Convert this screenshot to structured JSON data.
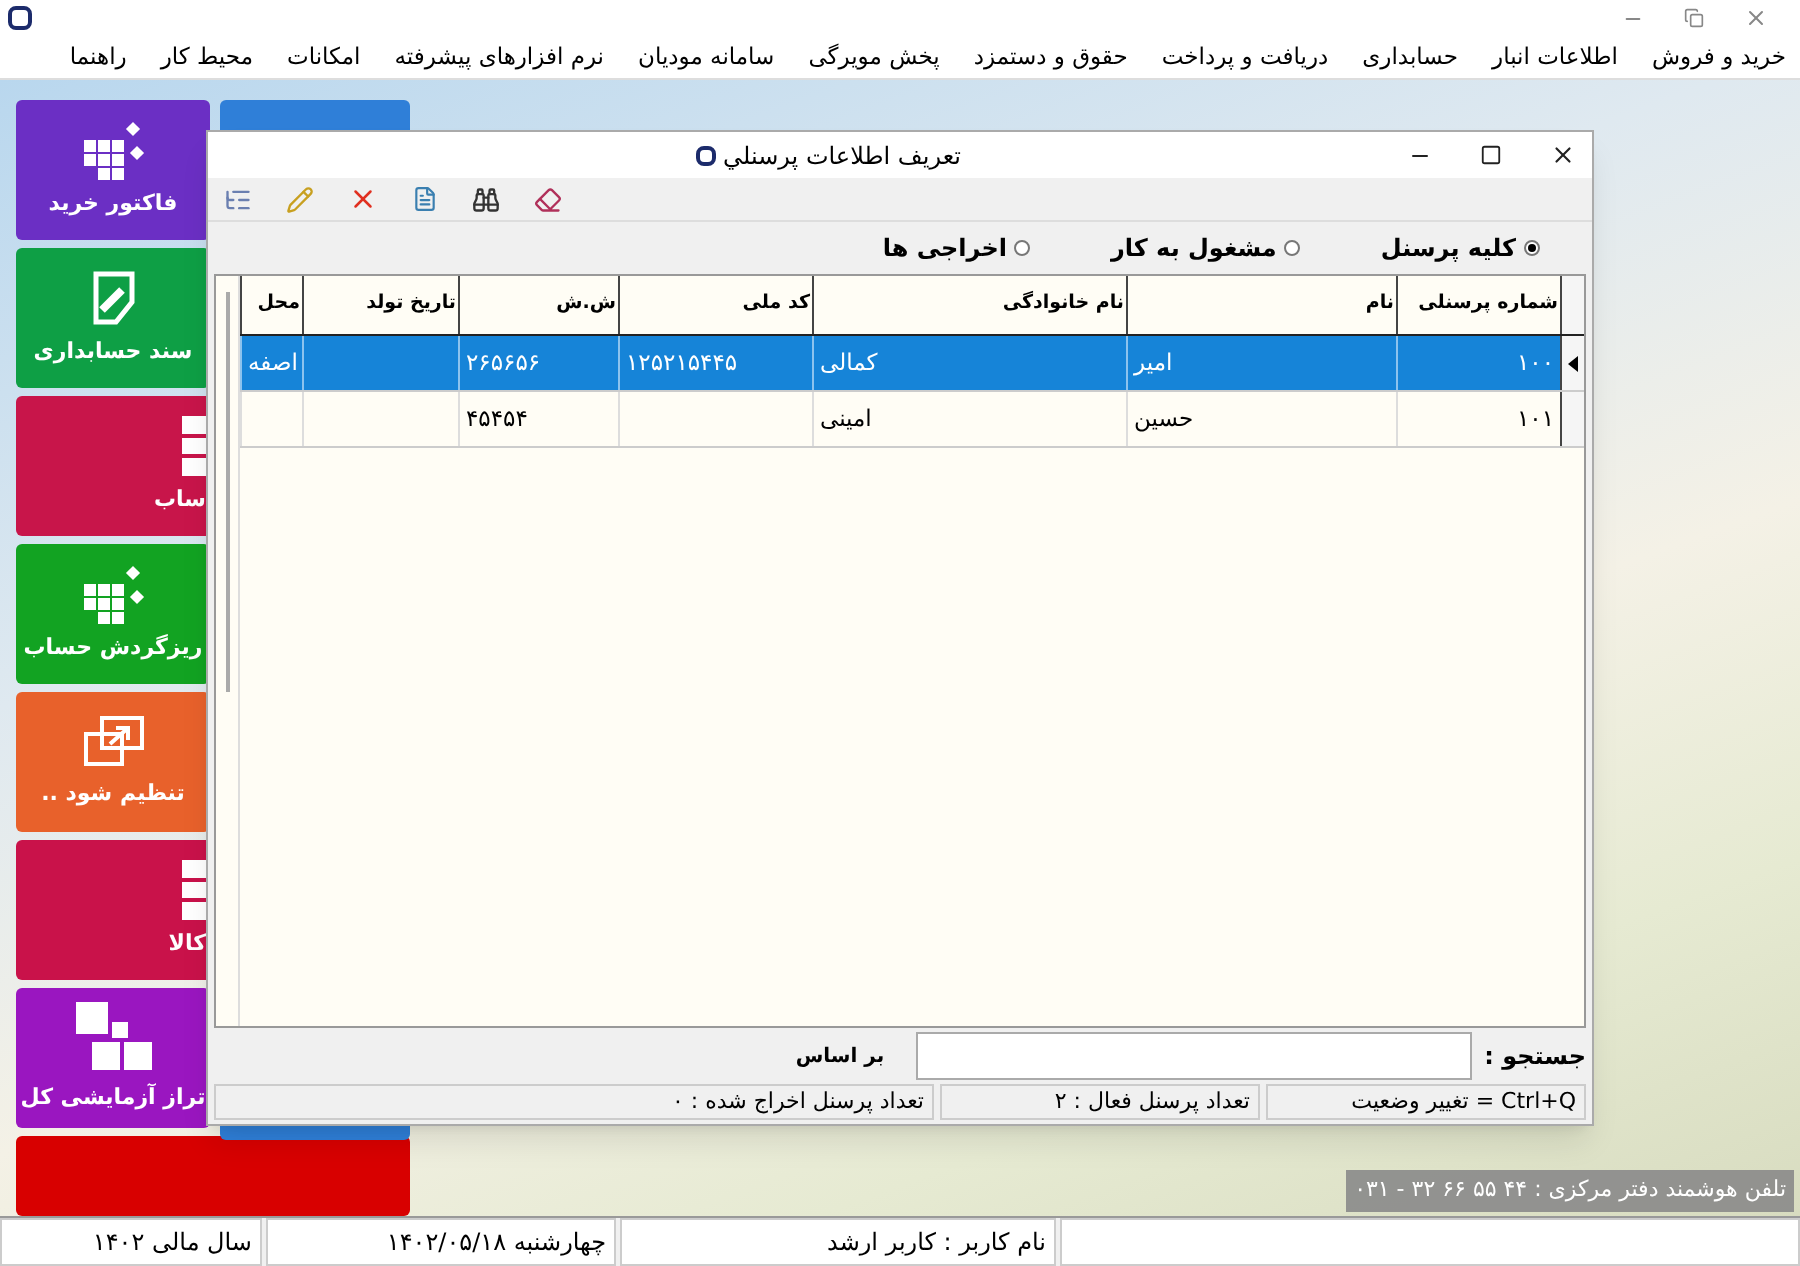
{
  "menu": [
    "خرید و فروش",
    "اطلاعات انبار",
    "حسابداری",
    "دریافت و پرداخت",
    "حقوق و دستمزد",
    "پخش مویرگی",
    "سامانه مودیان",
    "نرم افزارهای پیشرفته",
    "امکانات",
    "محیط کار",
    "راهنما"
  ],
  "tiles": [
    {
      "label": "فاکتور خرید",
      "color": "#6b2fc4",
      "kind": "cubes"
    },
    {
      "label": "سند حسابداری",
      "color": "#0e9f45",
      "kind": "note"
    },
    {
      "label": "ساب",
      "color": "#c8154a",
      "kind": "grid"
    },
    {
      "label": "ریزگردش حساب",
      "color": "#12a322",
      "kind": "cubes"
    },
    {
      "label": "تنظیم شود ..",
      "color": "#e8612b",
      "kind": "external"
    },
    {
      "label": "کالا",
      "color": "#c9124a",
      "kind": "grid"
    },
    {
      "label": "تراز آزمایشی کل",
      "color": "#9a16c0",
      "kind": "squares"
    },
    {
      "color": "#d80000",
      "kind": "blank"
    }
  ],
  "dialog": {
    "title": "تعریف اطلاعات پرسنلي",
    "radios": [
      {
        "label": "کلیه پرسنل",
        "selected": true
      },
      {
        "label": "مشغول به کار",
        "selected": false
      },
      {
        "label": "اخراجی ها",
        "selected": false
      }
    ],
    "table": {
      "columns": [
        "شماره پرسنلی",
        "نام",
        "نام خانوادگی",
        "کد ملی",
        "ش.ش",
        "تاریخ تولد",
        "محل"
      ],
      "rows": [
        {
          "selected": true,
          "cells": [
            "۱۰۰",
            "امیر",
            "کمالی",
            "۱۲۵۲۱۵۴۴۵",
            "۲۶۵۶۵۶",
            "",
            "اصفه"
          ]
        },
        {
          "selected": false,
          "cells": [
            "۱۰۱",
            "حسین",
            "امینی",
            "",
            "۴۵۴۵۴",
            "",
            ""
          ]
        }
      ]
    },
    "search": {
      "label": "جستجو :",
      "by_label": "بر اساس"
    },
    "status": [
      "Ctrl+Q = تغییر وضعیت",
      "تعداد پرسنل فعال  :  ۲",
      "تعداد پرسنل اخراج شده  :  ۰"
    ]
  },
  "info_label": "تلفن هوشمند دفتر مرکزی :  ۴۴ ۵۵ ۶۶ ۳۲ - ۰۳۱",
  "status_bar": [
    "نام کاربر : کاربر ارشد",
    "چهارشنبه  ۱۴۰۲/۰۵/۱۸",
    "سال مالی ۱۴۰۲"
  ]
}
